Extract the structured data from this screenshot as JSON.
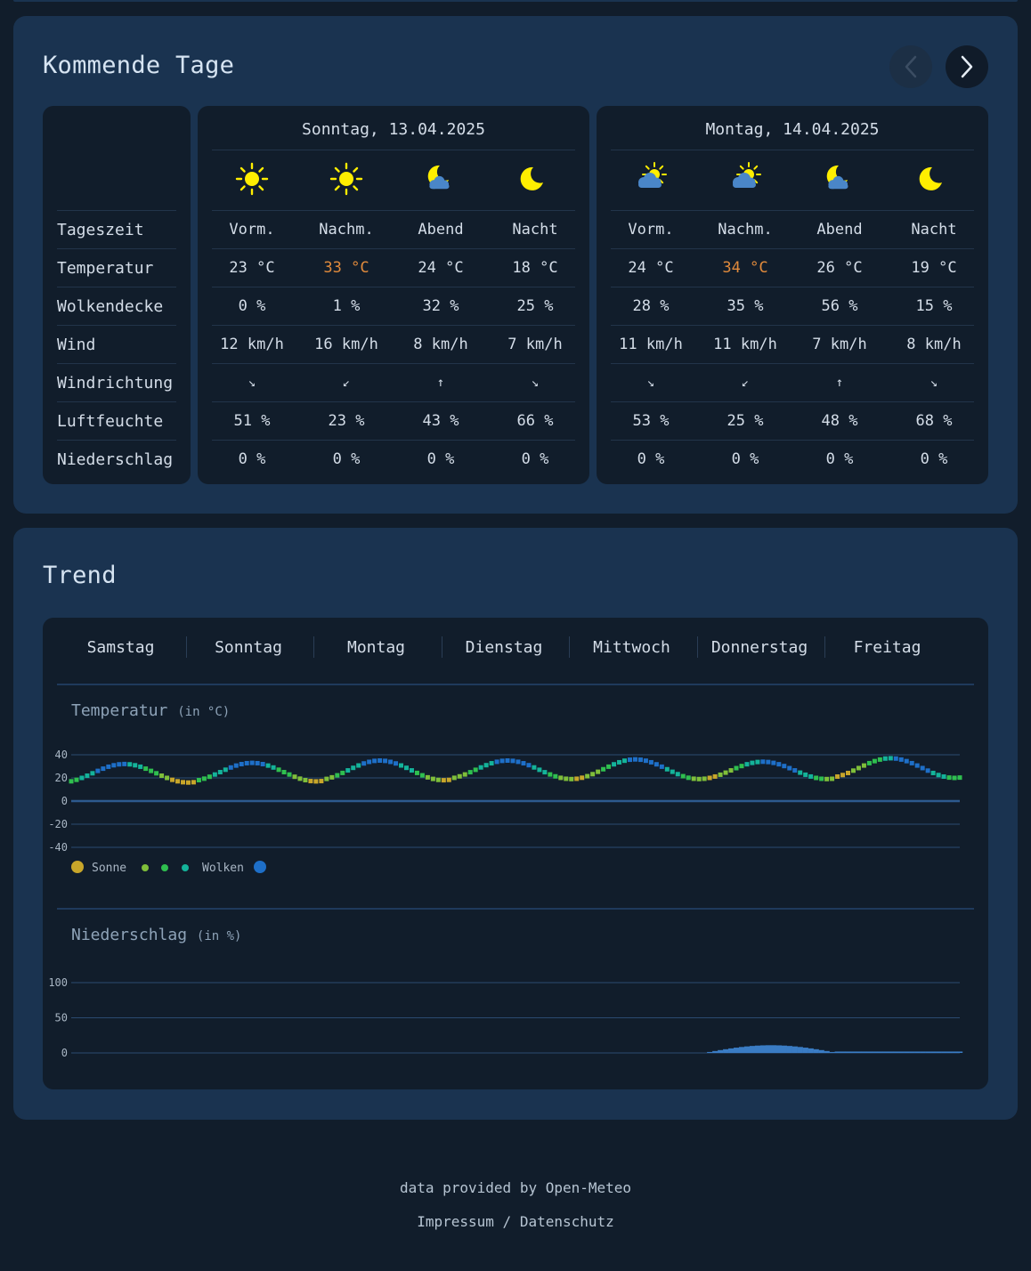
{
  "upcoming": {
    "title": "Kommende Tage",
    "row_labels": [
      "Tageszeit",
      "Temperatur",
      "Wolkendecke",
      "Wind",
      "Windrichtung",
      "Luftfeuchte",
      "Niederschlag"
    ],
    "days": [
      {
        "date": "Sonntag, 13.04.2025",
        "periods": [
          "Vorm.",
          "Nachm.",
          "Abend",
          "Nacht"
        ],
        "icons": [
          "sun-icon",
          "sun-icon",
          "moon-cloud-icon",
          "moon-icon"
        ],
        "temperature": [
          "23 °C",
          "33 °C",
          "24 °C",
          "18 °C"
        ],
        "cloud_cover": [
          "0 %",
          "1 %",
          "32 %",
          "25 %"
        ],
        "wind": [
          "12 km/h",
          "16 km/h",
          "8 km/h",
          "7 km/h"
        ],
        "wind_direction": [
          "↘",
          "↙",
          "↑",
          "↘"
        ],
        "humidity": [
          "51 %",
          "23 %",
          "43 %",
          "66 %"
        ],
        "precipitation": [
          "0 %",
          "0 %",
          "0 %",
          "0 %"
        ]
      },
      {
        "date": "Montag, 14.04.2025",
        "periods": [
          "Vorm.",
          "Nachm.",
          "Abend",
          "Nacht"
        ],
        "icons": [
          "sun-cloud-icon",
          "sun-cloud-icon",
          "moon-cloud-icon",
          "moon-icon"
        ],
        "temperature": [
          "24 °C",
          "34 °C",
          "26 °C",
          "19 °C"
        ],
        "cloud_cover": [
          "28 %",
          "35 %",
          "56 %",
          "15 %"
        ],
        "wind": [
          "11 km/h",
          "11 km/h",
          "7 km/h",
          "8 km/h"
        ],
        "wind_direction": [
          "↘",
          "↙",
          "↑",
          "↘"
        ],
        "humidity": [
          "53 %",
          "25 %",
          "48 %",
          "68 %"
        ],
        "precipitation": [
          "0 %",
          "0 %",
          "0 %",
          "0 %"
        ]
      }
    ]
  },
  "trend": {
    "title": "Trend",
    "days": [
      "Samstag",
      "Sonntag",
      "Montag",
      "Dienstag",
      "Mittwoch",
      "Donnerstag",
      "Freitag"
    ],
    "temperature_title": "Temperatur",
    "temperature_unit": "(in °C)",
    "precip_title": "Niederschlag",
    "precip_unit": "(in %)",
    "legend": {
      "sun": "Sonne",
      "clouds": "Wolken"
    }
  },
  "colors": {
    "sun": "#c8a62a",
    "mid1": "#7fbf3a",
    "mid2": "#2fbf4f",
    "mid3": "#14b39a",
    "clouds": "#1e6fc8",
    "hot_text": "#e08a3c",
    "precip": "#3a7cc4",
    "icon_yellow": "#ffee00",
    "icon_cloud": "#4a86c8"
  },
  "chart_data": [
    {
      "type": "scatter",
      "title": "Temperatur",
      "ylabel": "(in °C)",
      "categories": [
        "Samstag",
        "Sonntag",
        "Montag",
        "Dienstag",
        "Mittwoch",
        "Donnerstag",
        "Freitag"
      ],
      "ylim": [
        -40,
        40
      ],
      "yticks": [
        40,
        20,
        0,
        -20,
        -40
      ],
      "days_daily_min_max": [
        [
          16,
          32
        ],
        [
          17,
          33
        ],
        [
          18,
          35
        ],
        [
          19,
          35
        ],
        [
          19,
          36
        ],
        [
          19,
          34
        ],
        [
          20,
          37
        ]
      ],
      "color_scale": [
        "Sonne",
        "Wolken"
      ],
      "grid": true,
      "legend_position": "bottom-left"
    },
    {
      "type": "area",
      "title": "Niederschlag",
      "ylabel": "(in %)",
      "categories": [
        "Samstag",
        "Sonntag",
        "Montag",
        "Dienstag",
        "Mittwoch",
        "Donnerstag",
        "Freitag"
      ],
      "ylim": [
        0,
        100
      ],
      "yticks": [
        100,
        50,
        0
      ],
      "daily_max": [
        0,
        0,
        0,
        0,
        0,
        11,
        2
      ],
      "grid": true
    }
  ],
  "footer": {
    "credit": "data provided by Open-Meteo",
    "links": "Impressum / Datenschutz"
  }
}
